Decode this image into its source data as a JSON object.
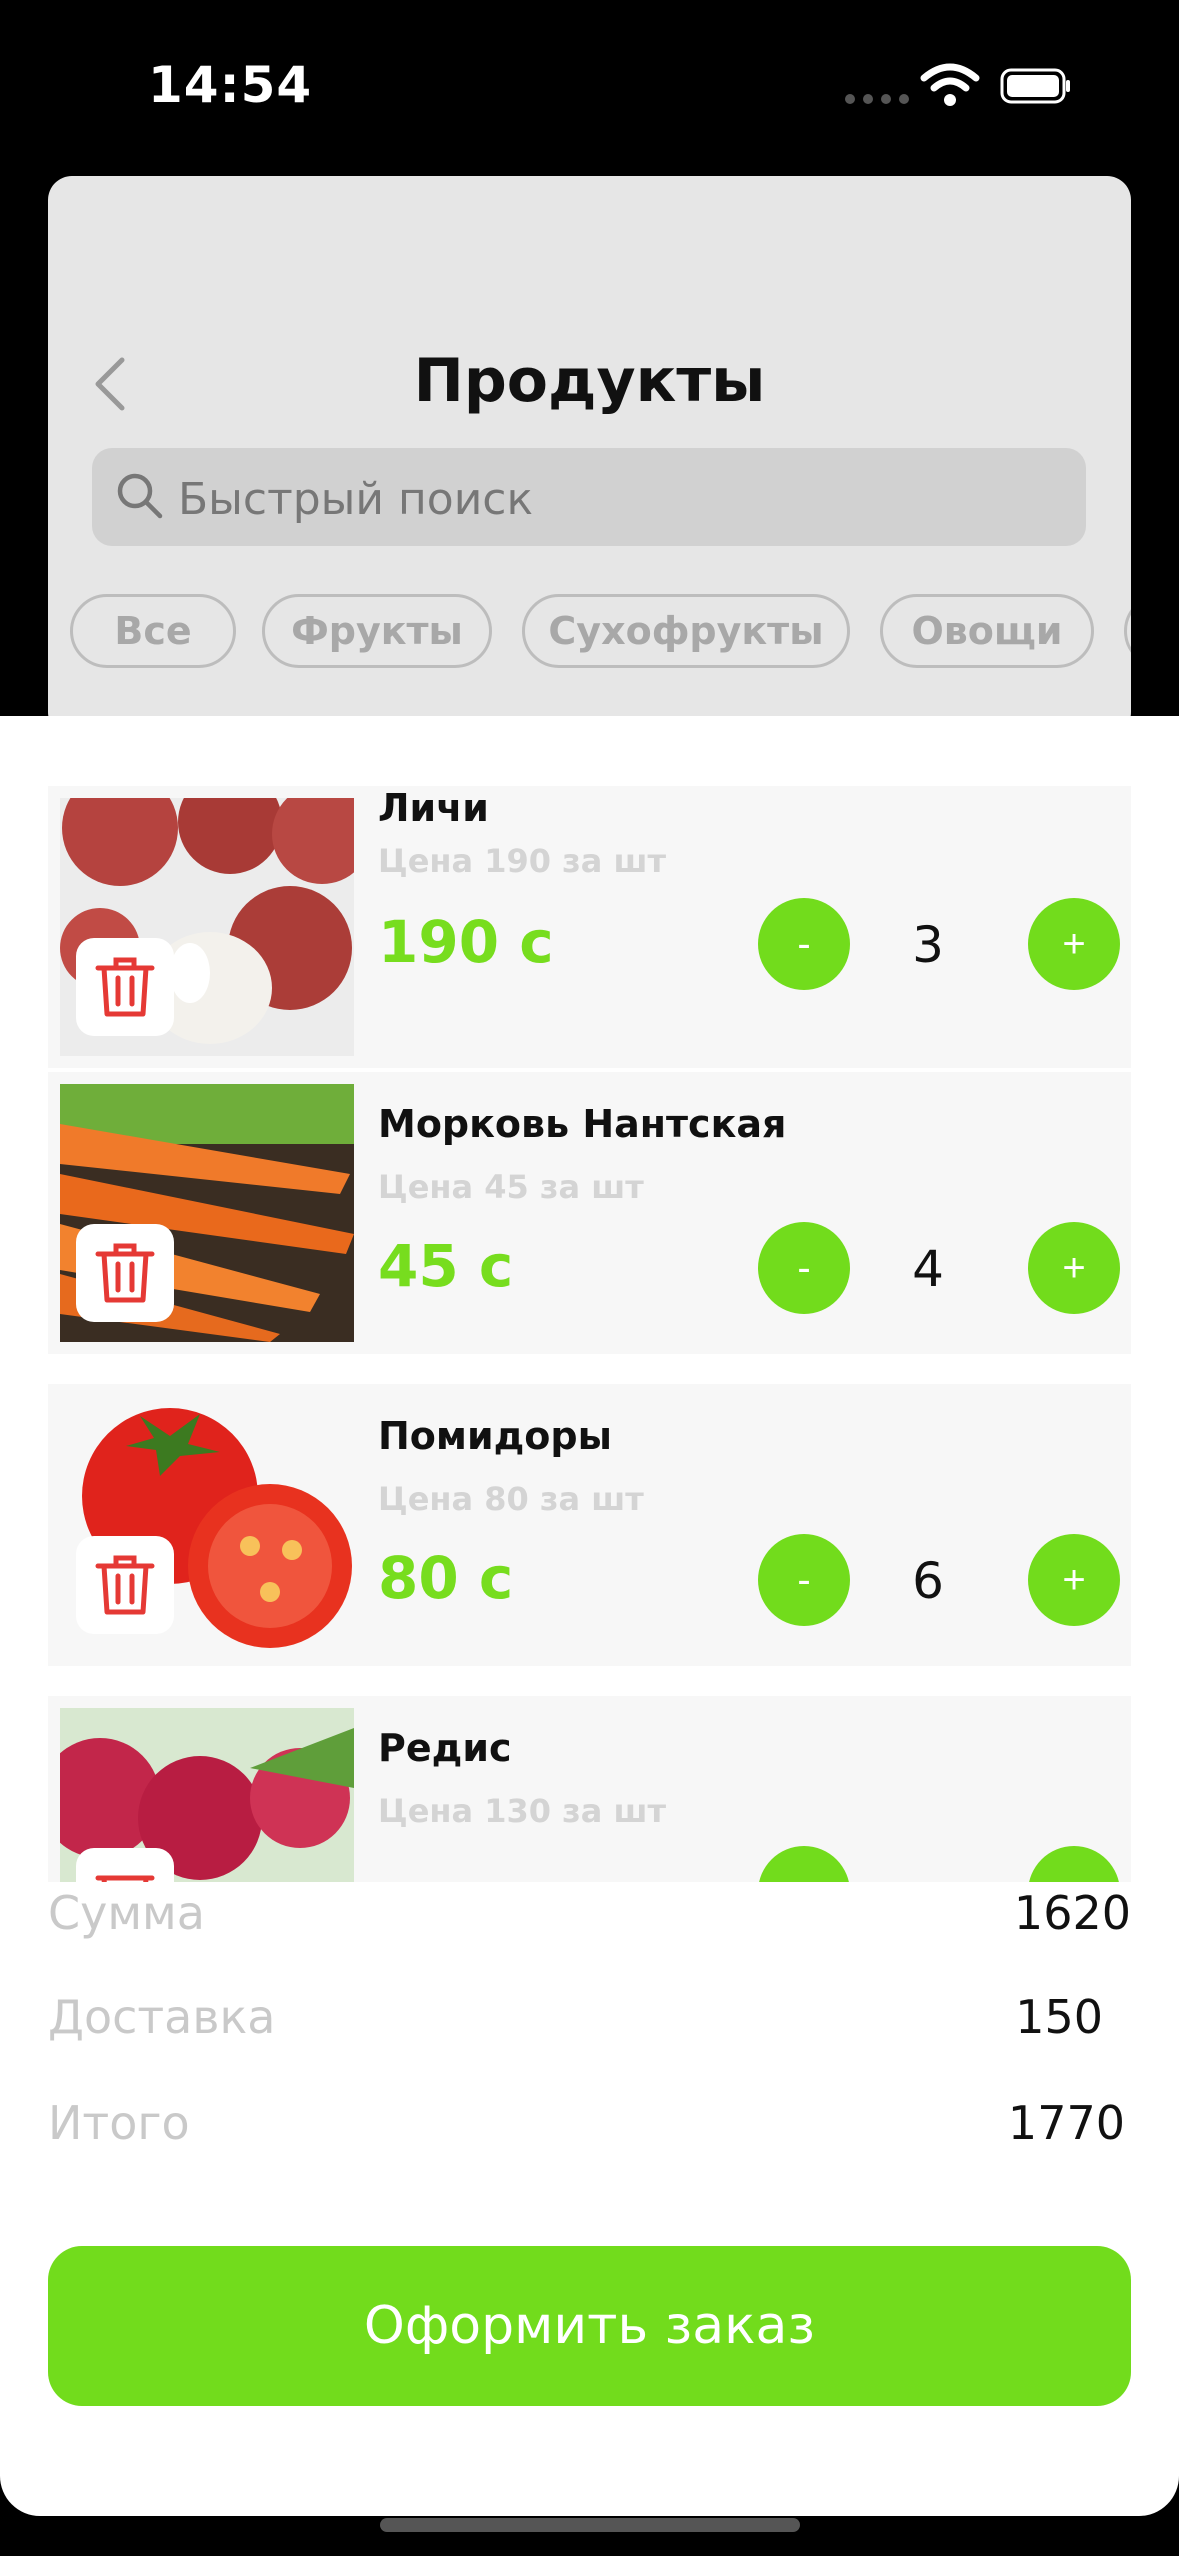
{
  "status_bar": {
    "time": "14:54"
  },
  "header": {
    "title": "Продукты",
    "search_placeholder": "Быстрый поиск",
    "chips": [
      "Все",
      "Фрукты",
      "Сухофрукты",
      "Овощи"
    ]
  },
  "cart": {
    "items": [
      {
        "name": "Личи",
        "unit_price": "Цена 190 за шт",
        "price": "190 с",
        "qty": "3",
        "minus": "-",
        "plus": "+"
      },
      {
        "name": "Морковь Нантская",
        "unit_price": "Цена 45 за шт",
        "price": "45 с",
        "qty": "4",
        "minus": "-",
        "plus": "+"
      },
      {
        "name": "Помидоры",
        "unit_price": "Цена 80 за шт",
        "price": "80 с",
        "qty": "6",
        "minus": "-",
        "plus": "+"
      },
      {
        "name": "Редис",
        "unit_price": "Цена 130 за шт",
        "price": "",
        "qty": "",
        "minus": "-",
        "plus": "+"
      }
    ]
  },
  "totals": {
    "sum_label": "Сумма",
    "sum_value": "1620",
    "delivery_label": "Доставка",
    "delivery_value": "150",
    "total_label": "Итого",
    "total_value": "1770"
  },
  "order_button": "Оформить заказ",
  "colors": {
    "accent": "#72dc1c",
    "price": "#77dd1e",
    "trash": "#e53935"
  },
  "icons": [
    "chevron-left-icon",
    "search-icon",
    "trash-icon",
    "wifi-icon",
    "battery-icon"
  ]
}
